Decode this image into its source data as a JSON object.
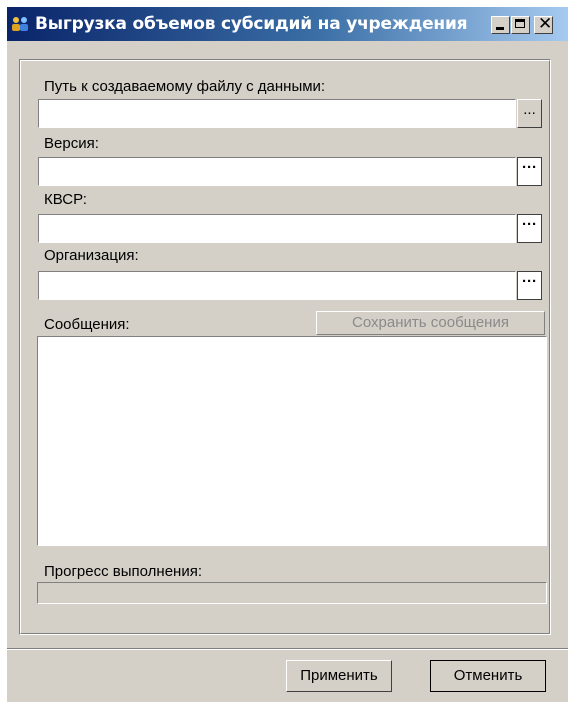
{
  "window": {
    "title": "Выгрузка объемов субсидий на учреждения",
    "title_icon": "people-icon",
    "controls": {
      "minimize": "minimize-icon",
      "maximize": "maximize-icon",
      "close": "✕"
    },
    "titlebar_colors": [
      "#0a246a",
      "#a6caf0"
    ],
    "face_color": "#d4d0c8"
  },
  "form": {
    "file_path": {
      "label": "Путь к создаваемому файлу с данными:",
      "value": "",
      "button": "..."
    },
    "version": {
      "label": "Версия:",
      "value": "",
      "button": "···"
    },
    "kvsr": {
      "label": "КВСР:",
      "value": "",
      "button": "···"
    },
    "organization": {
      "label": "Организация:",
      "value": "",
      "button": "···"
    },
    "messages": {
      "label": "Сообщения:",
      "save_button": "Сохранить сообщения",
      "content": ""
    },
    "progress": {
      "label": "Прогресс выполнения:",
      "value": 0
    }
  },
  "footer": {
    "apply": "Применить",
    "cancel": "Отменить"
  }
}
